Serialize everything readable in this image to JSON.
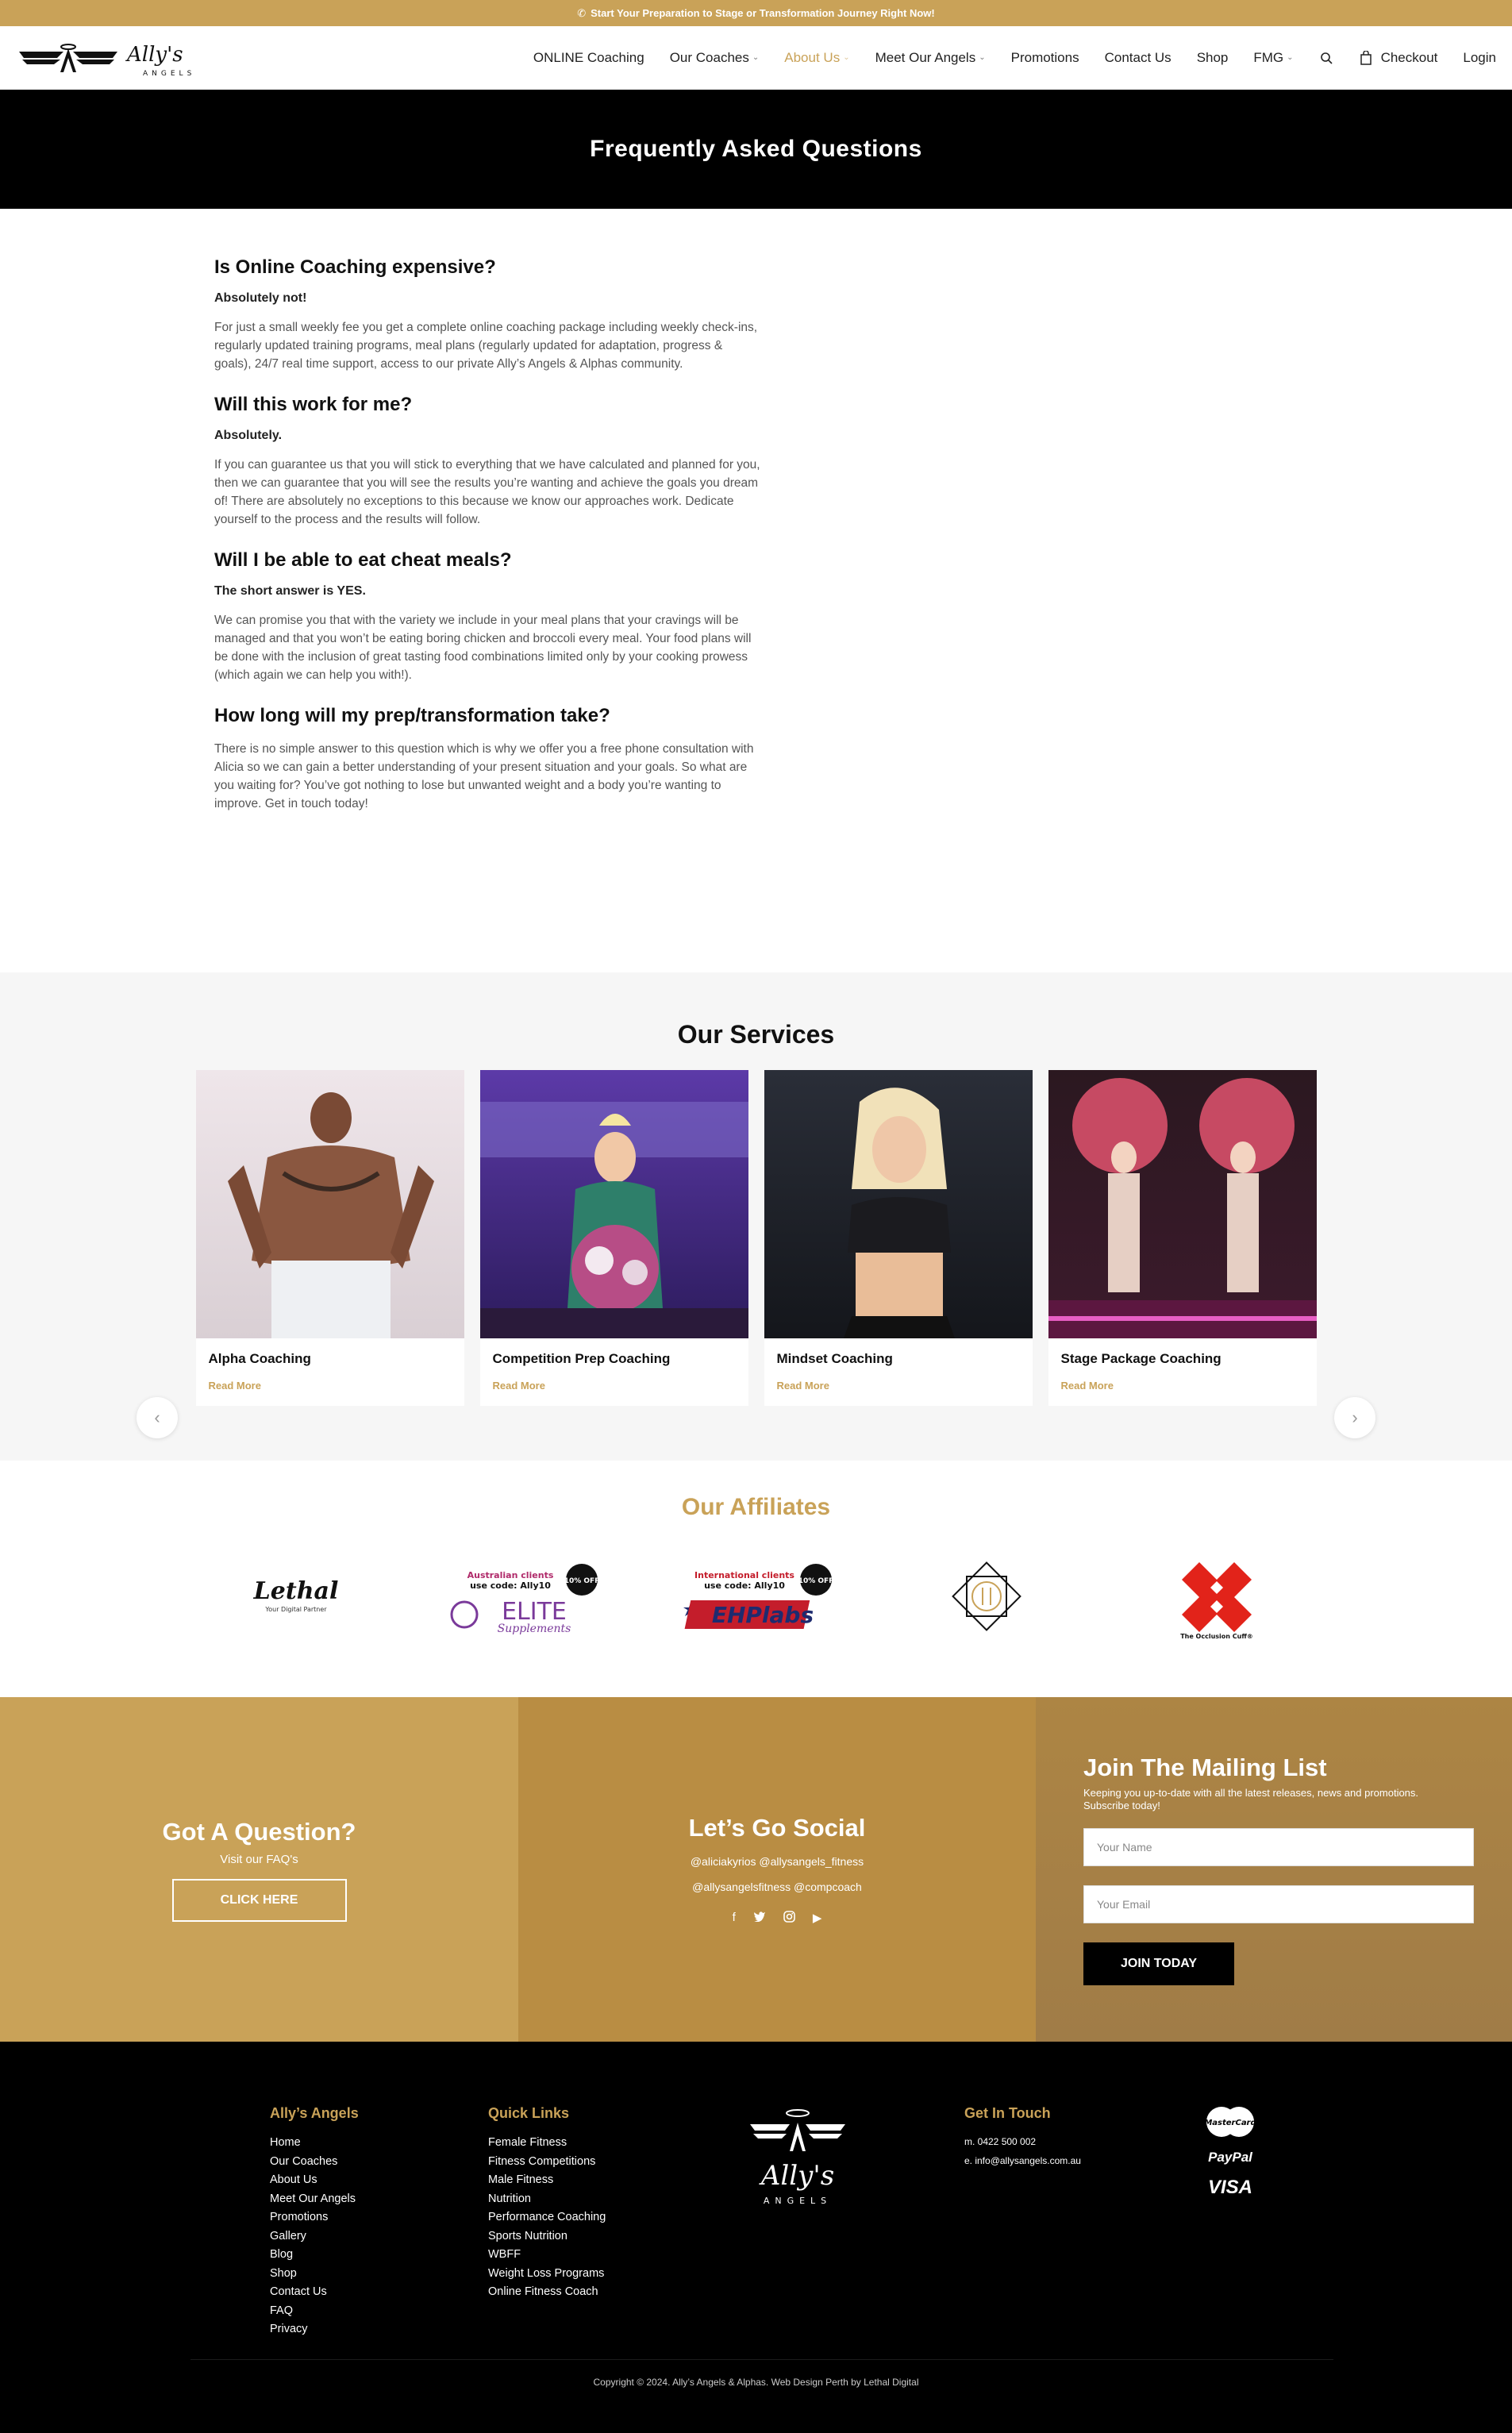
{
  "topbar": {
    "text": "Start Your Preparation to Stage or Transformation Journey Right Now!"
  },
  "brand": {
    "name": "Ally's",
    "tag": "ANGELS"
  },
  "nav": {
    "items": [
      {
        "label": "ONLINE Coaching"
      },
      {
        "label": "Our Coaches"
      },
      {
        "label": "About Us"
      },
      {
        "label": "Meet Our Angels"
      },
      {
        "label": "Promotions"
      },
      {
        "label": "Contact Us"
      },
      {
        "label": "Shop"
      },
      {
        "label": "FMG"
      }
    ],
    "checkout": "Checkout",
    "login": "Login"
  },
  "hero": {
    "title": "Frequently Asked Questions"
  },
  "faq": [
    {
      "q": "Is Online Coaching expensive?",
      "lead": "Absolutely not!",
      "a": "For just a small weekly fee you get a complete online coaching package including weekly check-ins, regularly updated training programs, meal plans (regularly updated for adaptation, progress & goals), 24/7 real time support, access to our private Ally’s Angels & Alphas community."
    },
    {
      "q": "Will this work for me?",
      "lead": "Absolutely.",
      "a": "If you can guarantee us that you will stick to everything that we have calculated and planned for you, then we can guarantee that you will see the results you’re wanting and achieve the goals you dream of! There are absolutely no exceptions to this because we know our approaches work. Dedicate yourself to the process and the results will follow."
    },
    {
      "q": "Will I be able to eat cheat meals?",
      "lead": "The short answer is YES.",
      "a": "We can promise you that with the variety we include in your meal plans that your cravings will be managed and that you won’t be eating boring chicken and broccoli every meal. Your food plans will be done with the inclusion of great tasting food combinations limited only by your cooking prowess (which again we can help you with!)."
    },
    {
      "q": "How long will my prep/transformation take?",
      "lead": "",
      "a": "There is no simple answer to this question which is why we offer you a free phone consultation with Alicia so we can gain a better understanding of your present situation and your goals. So what are you waiting for? You’ve got nothing to lose but unwanted weight and a body you’re wanting to improve. Get in touch today!"
    }
  ],
  "services": {
    "title": "Our Services",
    "cards": [
      {
        "title": "Alpha Coaching",
        "more": "Read More"
      },
      {
        "title": "Competition Prep Coaching",
        "more": "Read More"
      },
      {
        "title": "Mindset Coaching",
        "more": "Read More"
      },
      {
        "title": "Stage Package Coaching",
        "more": "Read More"
      }
    ]
  },
  "affiliates": {
    "title": "Our Affiliates",
    "lethal": {
      "name": "Lethal",
      "tag": "Your Digital Partner"
    },
    "elite": {
      "top1": "Australian clients",
      "top2": "use code: Ally10",
      "badge": "10% OFF",
      "name": "ELITE",
      "sub": "Supplements"
    },
    "ehp": {
      "top1": "International clients",
      "top2": "use code: Ally10",
      "badge": "10% OFF",
      "name": "EHPlabs"
    },
    "cuff": {
      "name": "The Occlusion Cuff®"
    }
  },
  "cta": {
    "question": {
      "title": "Got A Question?",
      "sub": "Visit our FAQ's",
      "button": "CLICK HERE"
    },
    "social": {
      "title": "Let’s Go Social",
      "line1": "@aliciakyrios @allysangels_fitness",
      "line2": "@allysangelsfitness @compcoach"
    },
    "mailing": {
      "title": "Join The Mailing List",
      "sub": "Keeping you up-to-date with all the latest releases, news and promotions. Subscribe today!",
      "name_ph": "Your Name",
      "email_ph": "Your Email",
      "button": "JOIN TODAY"
    }
  },
  "footer": {
    "col1": {
      "title": "Ally’s Angels",
      "links": [
        "Home",
        "Our Coaches",
        "About Us",
        "Meet Our Angels",
        "Promotions",
        "Gallery",
        "Blog",
        "Shop",
        "Contact Us",
        "FAQ",
        "Privacy"
      ]
    },
    "col2": {
      "title": "Quick Links",
      "links": [
        "Female Fitness",
        "Fitness Competitions",
        "Male Fitness",
        "Nutrition",
        "Performance Coaching",
        "Sports Nutrition",
        "WBFF",
        "Weight Loss Programs",
        "Online Fitness Coach"
      ]
    },
    "contact": {
      "title": "Get In Touch",
      "phone": "m. 0422 500 002",
      "email": "e. info@allysangels.com.au"
    },
    "payments": {
      "mastercard": "MasterCard",
      "paypal": "PayPal",
      "visa": "VISA"
    },
    "copyright": "Copyright © 2024. Ally’s Angels & Alphas. Web Design Perth by Lethal Digital"
  },
  "colors": {
    "gold": "#c9a258",
    "black": "#000000"
  }
}
